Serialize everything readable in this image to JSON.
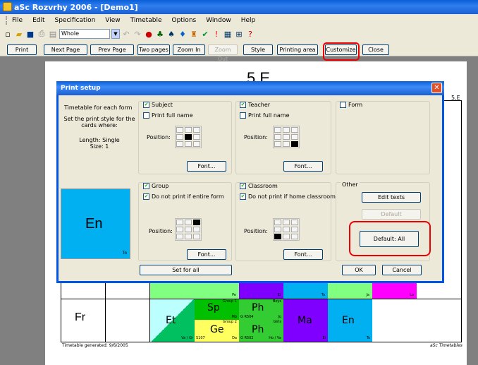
{
  "window": {
    "title": "aSc Rozvrhy 2006  - [Demo1]"
  },
  "menu": [
    "File",
    "Edit",
    "Specification",
    "View",
    "Timetable",
    "Options",
    "Window",
    "Help"
  ],
  "toolbar": {
    "view_select": "Whole"
  },
  "preview_bar": [
    "Print",
    "Next Page",
    "Prev Page",
    "Two pages",
    "Zoom In",
    "Zoom Out",
    "Style",
    "Printing area",
    "Customize",
    "Close"
  ],
  "page": {
    "title": "5.E",
    "corner": "5.E",
    "footer_left": "Timetable generated: 9/6/2005",
    "footer_right": "aSc Timetables",
    "row_day": "Fr",
    "top_row": [
      {
        "text": "Pe",
        "color": "#80ff80"
      },
      {
        "text": "Ei",
        "color": "#8000ff"
      },
      {
        "text": "To",
        "color": "#00b0f0"
      },
      {
        "text": "Ja",
        "color": "#80ff80"
      },
      {
        "text": "Lo",
        "color": "#ff00ff"
      }
    ],
    "cells": {
      "et": "Et",
      "et_small": "Va / Gr",
      "sp": "Sp",
      "sp_group": "Group 1",
      "sp_room": "Mb",
      "ge": "Ge",
      "ge_group": "Group 2",
      "ge_room": "S107",
      "ge_small": "Da",
      "ph1": "Ph",
      "ph1_small": "Boys",
      "ph1_room": "G R504",
      "ph1_t": "Jo",
      "ph2": "Ph",
      "ph2_small": "Girls",
      "ph2_room": "G R502",
      "ph2_t": "Ho / Va",
      "ma": "Ma",
      "ma_t": "Ei",
      "en": "En",
      "en_t": "To"
    }
  },
  "dialog": {
    "title": "Print setup",
    "left_text": "Timetable for each form",
    "left_text2": "Set the print style for the cards where:",
    "left_text3": "Length: Single",
    "left_text4": "Size: 1",
    "preview_label": "En",
    "preview_small": "To",
    "subject": "Subject",
    "teacher": "Teacher",
    "form": "Form",
    "print_full_name": "Print full name",
    "position": "Position:",
    "font": "Font...",
    "group": "Group",
    "classroom": "Classroom",
    "no_print_form": "Do not print if entire form",
    "no_print_home": "Do not print if home classroom",
    "other": "Other",
    "edit_texts": "Edit texts",
    "default": "Default",
    "default_all": "Default: All",
    "set_for_all": "Set for all",
    "ok": "OK",
    "cancel": "Cancel"
  }
}
